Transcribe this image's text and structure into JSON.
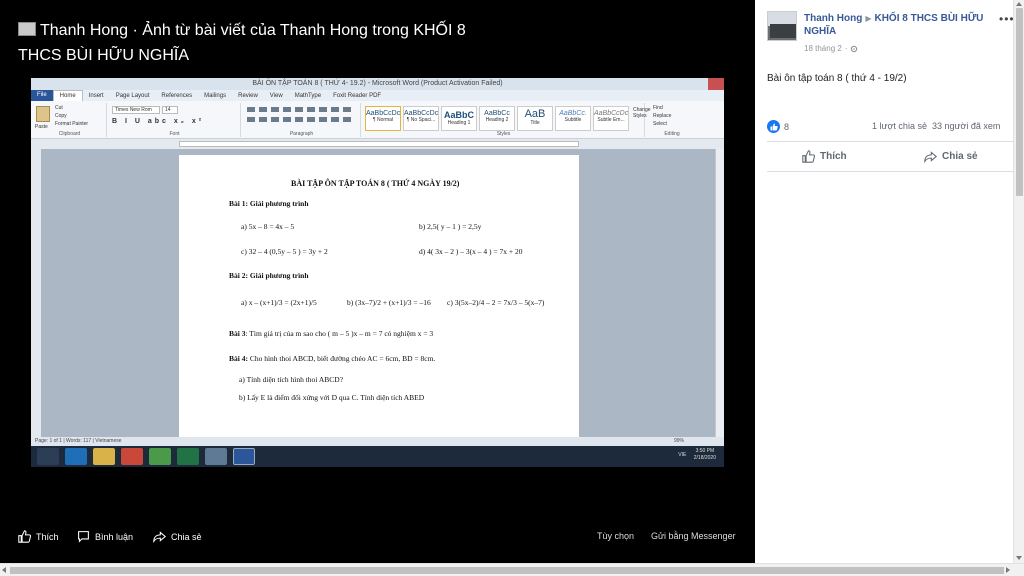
{
  "viewer": {
    "title": "Thanh Hong · Ảnh từ bài viết của Thanh Hong trong KHỐI 8 THCS BÙI HỮU NGHĨA",
    "word_window_title": "BÀI ÔN TẬP TOÁN 8 ( THỨ 4- 19.2) - Microsoft Word (Product Activation Failed)",
    "word_tabs": [
      "File",
      "Home",
      "Insert",
      "Page Layout",
      "References",
      "Mailings",
      "Review",
      "View",
      "MathType",
      "Foxit Reader PDF"
    ],
    "ribbon": {
      "font_name": "Times New Rom",
      "font_size": "14",
      "clipboard_items": [
        "Cut",
        "Copy",
        "Format Painter"
      ],
      "paste": "Paste",
      "groups": [
        "Clipboard",
        "Font",
        "Paragraph",
        "Styles",
        "Editing"
      ],
      "styles": [
        {
          "preview": "AaBbCcDc",
          "name": "¶ Normal"
        },
        {
          "preview": "AaBbCcDc",
          "name": "¶ No Spaci..."
        },
        {
          "preview": "AaBbC",
          "name": "Heading 1"
        },
        {
          "preview": "AaBbCc",
          "name": "Heading 2"
        },
        {
          "preview": "AaB",
          "name": "Title"
        },
        {
          "preview": "AaBbCc.",
          "name": "Subtitle"
        },
        {
          "preview": "AaBbCcDc",
          "name": "Subtle Em..."
        }
      ],
      "change_styles": "Change Styles",
      "editing": [
        "Find",
        "Replace",
        "Select"
      ]
    },
    "document": {
      "heading": "BÀI TẬP ÔN TẬP TOÁN 8 ( THỨ 4 NGÀY 19/2)",
      "bai1_title": "Bài 1: Giải phương trình",
      "bai1_a": "a) 5x – 8 = 4x – 5",
      "bai1_b": "b) 2,5( y – 1 ) = 2,5y",
      "bai1_c": "c) 32 – 4 (0,5y – 5 ) = 3y + 2",
      "bai1_d": "d) 4( 3x – 2 ) – 3(x – 4 ) = 7x + 20",
      "bai2_title": "Bài 2: Giải phương trình",
      "bai2_a": "a) x – (x+1)/3 = (2x+1)/5",
      "bai2_b": "b) (3x–7)/2 + (x+1)/3 = –16",
      "bai2_c": "c) 3(5x–2)/4 – 2 = 7x/3 – 5(x–7)",
      "bai3_label": "Bài 3",
      "bai3_text": ": Tìm giá trị của m sao cho ( m – 5 )x – m = 7 có nghiệm x = 3",
      "bai4_label": "Bài 4:",
      "bai4_text": " Cho hình thoi ABCD, biết đường chéo AC = 6cm, BD = 8cm.",
      "bai4_a": "a)  Tính diện tích hình thoi ABCD?",
      "bai4_b": "b)  Lấy E là điểm đối xứng với D qua C. Tính diện tích ABED"
    },
    "status_bar": "Page: 1 of 1  |  Words: 117  |  Vietnamese",
    "zoom": "99%",
    "clock_time": "3:50 PM",
    "clock_date": "2/18/2020",
    "language": "VIE",
    "actions": {
      "like": "Thích",
      "comment": "Bình luận",
      "share": "Chia sẻ",
      "options": "Tùy chọn",
      "send_messenger": "Gửi bằng Messenger"
    }
  },
  "panel": {
    "author": "Thanh Hong",
    "group": "KHỐI 8 THCS BÙI HỮU NGHĨA",
    "time": "18 tháng 2",
    "post_text": "Bài ôn tập toán 8 ( thứ 4 - 19/2)",
    "like_count": "8",
    "shares": "1 lượt chia sẻ",
    "seen": "33 người đã xem",
    "like_label": "Thích",
    "share_label": "Chia sẻ"
  }
}
